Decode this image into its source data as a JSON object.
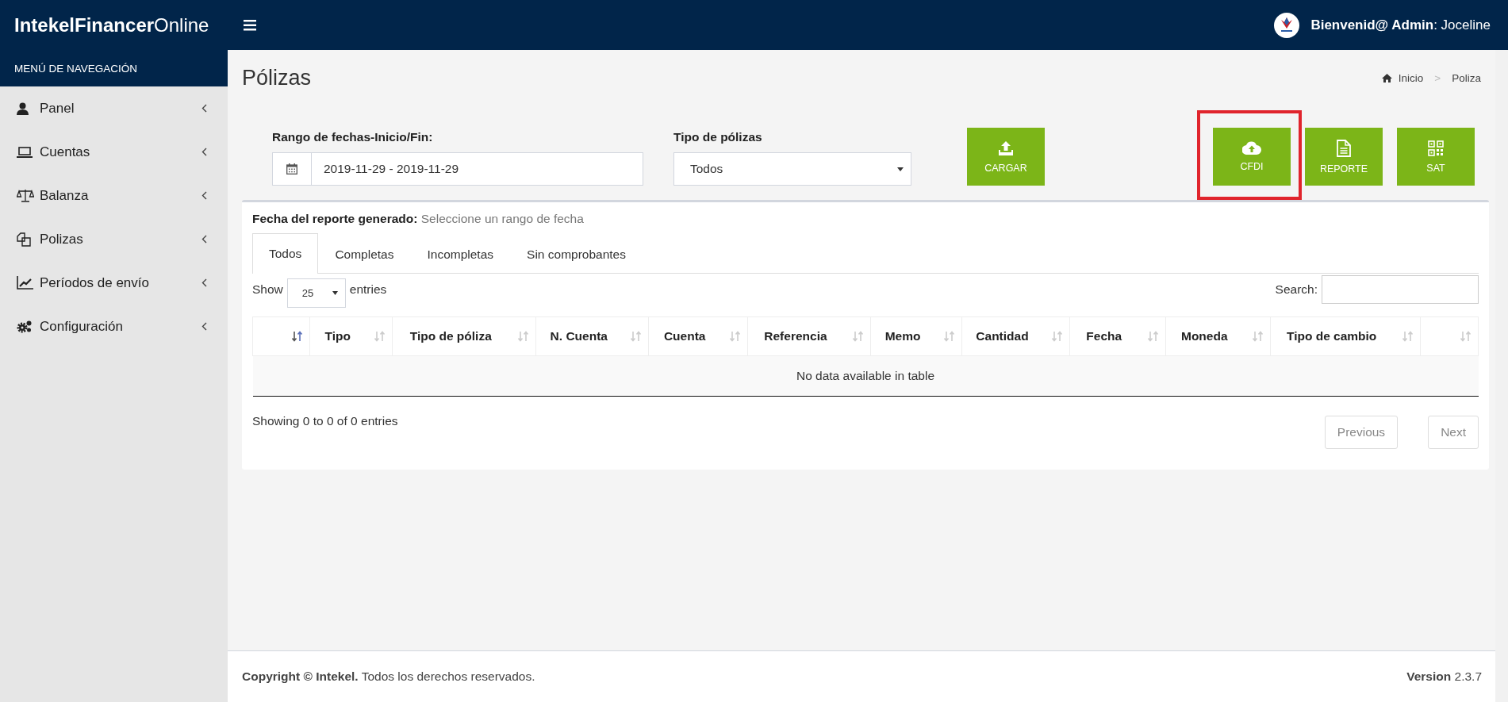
{
  "brand": "**IntekelFinancer**Online",
  "user": {
    "greeting": "**Bienvenid@ Admin**: Joceline"
  },
  "sidebar": {
    "header": "MENÚ DE NAVEGACIÓN",
    "items": [
      {
        "label": "Panel"
      },
      {
        "label": "Cuentas"
      },
      {
        "label": "Balanza"
      },
      {
        "label": "Polizas"
      },
      {
        "label": "Períodos de envío"
      },
      {
        "label": "Configuración"
      }
    ]
  },
  "page_title": "Pólizas",
  "breadcrumb": [
    {
      "kind": "link",
      "label": "Inicio"
    },
    {
      "kind": "separator",
      "label": ">"
    },
    {
      "kind": "current",
      "label": "Poliza"
    }
  ],
  "filters": {
    "date_range": {
      "label": "Rango de fechas-Inicio/Fin:",
      "value": "2019-11-29 - 2019-11-29"
    },
    "policy_type": {
      "label": "Tipo de pólizas",
      "value": "Todos"
    }
  },
  "actions": [
    {
      "label": "CARGAR",
      "highlighted": false
    },
    {
      "label": "CFDI",
      "highlighted": true
    },
    {
      "label": "REPORTE",
      "highlighted": false
    },
    {
      "label": "SAT",
      "highlighted": false
    }
  ],
  "report": {
    "label": "Fecha del reporte generado:",
    "value": "Seleccione un rango de fecha"
  },
  "tabs": [
    {
      "label": "Todos",
      "selected": true
    },
    {
      "label": "Completas",
      "selected": false
    },
    {
      "label": "Incompletas",
      "selected": false
    },
    {
      "label": "Sin comprobantes",
      "selected": false
    }
  ],
  "table": {
    "length": {
      "prefix": "Show",
      "value": "25",
      "suffix": "entries"
    },
    "search_label": "Search:",
    "columns": [
      {
        "sorted": true
      },
      {
        "label": "Tipo",
        "sorted": false
      },
      {
        "label": "Tipo de póliza",
        "sorted": false
      },
      {
        "label": "N. Cuenta",
        "sorted": false
      },
      {
        "label": "Cuenta",
        "sorted": false
      },
      {
        "label": "Referencia",
        "sorted": false
      },
      {
        "label": "Memo",
        "sorted": false
      },
      {
        "label": "Cantidad",
        "sorted": false
      },
      {
        "label": "Fecha",
        "sorted": false
      },
      {
        "label": "Moneda",
        "sorted": false
      },
      {
        "label": "Tipo de cambio",
        "sorted": false
      },
      {
        "sorted": false
      }
    ],
    "empty_message": "No data available in table",
    "info": "Showing 0 to 0 of 0 entries",
    "pagination": [
      {
        "label": "Previous",
        "disabled": true
      },
      {
        "label": "Next",
        "disabled": true
      }
    ]
  },
  "footer": {
    "copyright": "**Copyright © Intekel.** Todos los derechos reservados.",
    "version": "**Version** 2.3.7"
  }
}
